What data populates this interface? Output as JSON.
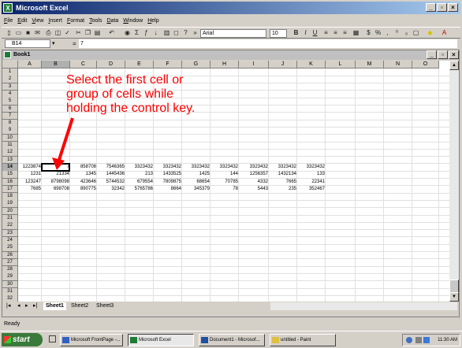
{
  "app": {
    "title": "Microsoft Excel",
    "logo": "excel-logo-icon"
  },
  "menu": [
    "File",
    "Edit",
    "View",
    "Insert",
    "Format",
    "Tools",
    "Data",
    "Window",
    "Help"
  ],
  "toolbar": {
    "font_name": "Arial",
    "font_size": "10",
    "bold": "B",
    "italic": "I",
    "underline": "U",
    "currency": "$",
    "percent": "%"
  },
  "formula": {
    "name_box": "B14",
    "equals": "=",
    "value": "7"
  },
  "book": {
    "title": "Book1"
  },
  "columns": [
    "A",
    "B",
    "C",
    "D",
    "E",
    "F",
    "G",
    "H",
    "I",
    "J",
    "K",
    "L",
    "M",
    "N",
    "O"
  ],
  "rows": [
    "1",
    "2",
    "3",
    "4",
    "5",
    "6",
    "7",
    "8",
    "9",
    "10",
    "11",
    "12",
    "13",
    "14",
    "15",
    "16",
    "17",
    "18",
    "19",
    "20",
    "21",
    "22",
    "23",
    "24",
    "25",
    "26",
    "27",
    "28",
    "29",
    "30",
    "31",
    "32"
  ],
  "cells": {
    "r14": [
      "1223874",
      "7",
      "858708",
      "7546365",
      "3323432",
      "3323432",
      "3323432",
      "3323432",
      "3323432",
      "3323432",
      "3323432"
    ],
    "r15": [
      "1231",
      "21334",
      "1345",
      "1445436",
      "213",
      "1433525",
      "1425",
      "144",
      "1256357",
      "1432134",
      "133"
    ],
    "r16": [
      "123247",
      "8798098",
      "423646",
      "5744532",
      "679554",
      "7809875",
      "68654",
      "70785",
      "4332",
      "7665",
      "22341"
    ],
    "r17": [
      "7685",
      "698708",
      "890775",
      "32342",
      "5765786",
      "8664",
      "345379",
      "78",
      "5443",
      "235",
      "352467"
    ]
  },
  "annotation": {
    "line1": "Select the first cell or",
    "line2": "group of cells while",
    "line3": "holding the control key."
  },
  "sheets": [
    "Sheet1",
    "Sheet2",
    "Sheet3"
  ],
  "status": "Ready",
  "taskbar": {
    "start": "start",
    "tasks": [
      "Microsoft FrontPage -...",
      "Microsoft Excel",
      "Document1 - Microsof...",
      "untitled - Paint"
    ],
    "clock": "11:30 AM"
  }
}
